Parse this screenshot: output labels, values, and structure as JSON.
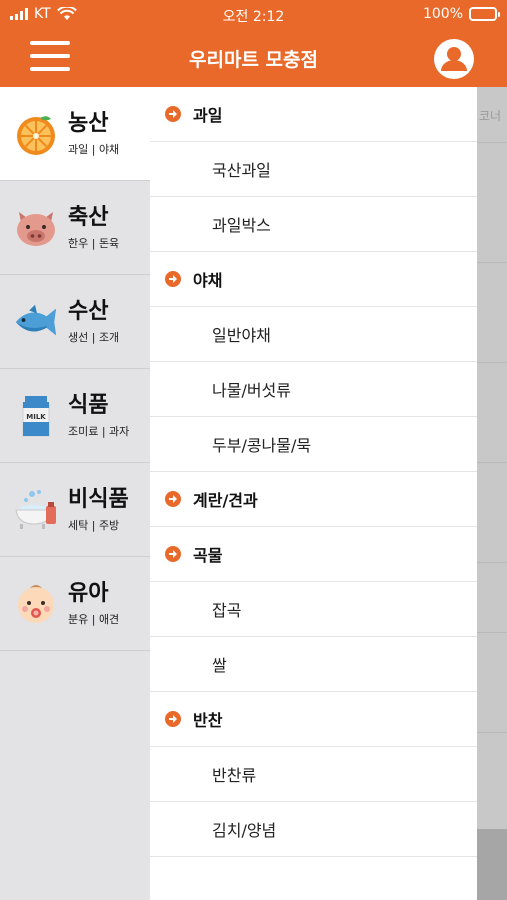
{
  "status_bar": {
    "carrier": "KT",
    "time": "오전 2:12",
    "battery": "100%",
    "battery_level": 1.0
  },
  "header": {
    "title": "우리마트 모충점",
    "menu_icon": "hamburger-menu-icon",
    "user_icon": "user-account-icon"
  },
  "categories": [
    {
      "name": "농산",
      "sub": "과일 | 야채",
      "icon": "orange-icon",
      "active": true
    },
    {
      "name": "축산",
      "sub": "한우 | 돈육",
      "icon": "pig-icon",
      "active": false
    },
    {
      "name": "수산",
      "sub": "생선 | 조개",
      "icon": "fish-icon",
      "active": false
    },
    {
      "name": "식품",
      "sub": "조미료 | 과자",
      "icon": "milk-carton-icon",
      "active": false,
      "icon_text": "MILK"
    },
    {
      "name": "비식품",
      "sub": "세탁 | 주방",
      "icon": "bath-tub-icon",
      "active": false
    },
    {
      "name": "유아",
      "sub": "분유 | 애견",
      "icon": "baby-icon",
      "active": false
    }
  ],
  "submenu": [
    {
      "type": "header",
      "label": "과일"
    },
    {
      "type": "child",
      "label": "국산과일"
    },
    {
      "type": "child",
      "label": "과일박스"
    },
    {
      "type": "header",
      "label": "야채"
    },
    {
      "type": "child",
      "label": "일반야채"
    },
    {
      "type": "child",
      "label": "나물/버섯류"
    },
    {
      "type": "child",
      "label": "두부/콩나물/묵"
    },
    {
      "type": "header",
      "label": "계란/견과"
    },
    {
      "type": "header",
      "label": "곡물"
    },
    {
      "type": "child",
      "label": "잡곡"
    },
    {
      "type": "child",
      "label": "쌀"
    },
    {
      "type": "header",
      "label": "반찬"
    },
    {
      "type": "child",
      "label": "반찬류"
    },
    {
      "type": "child",
      "label": "김치/양념"
    }
  ],
  "backdrop": {
    "ghost_text": "코너"
  },
  "colors": {
    "accent": "#e8692a",
    "panel_bg": "#e3e3e6",
    "active_bg": "#ffffff"
  }
}
